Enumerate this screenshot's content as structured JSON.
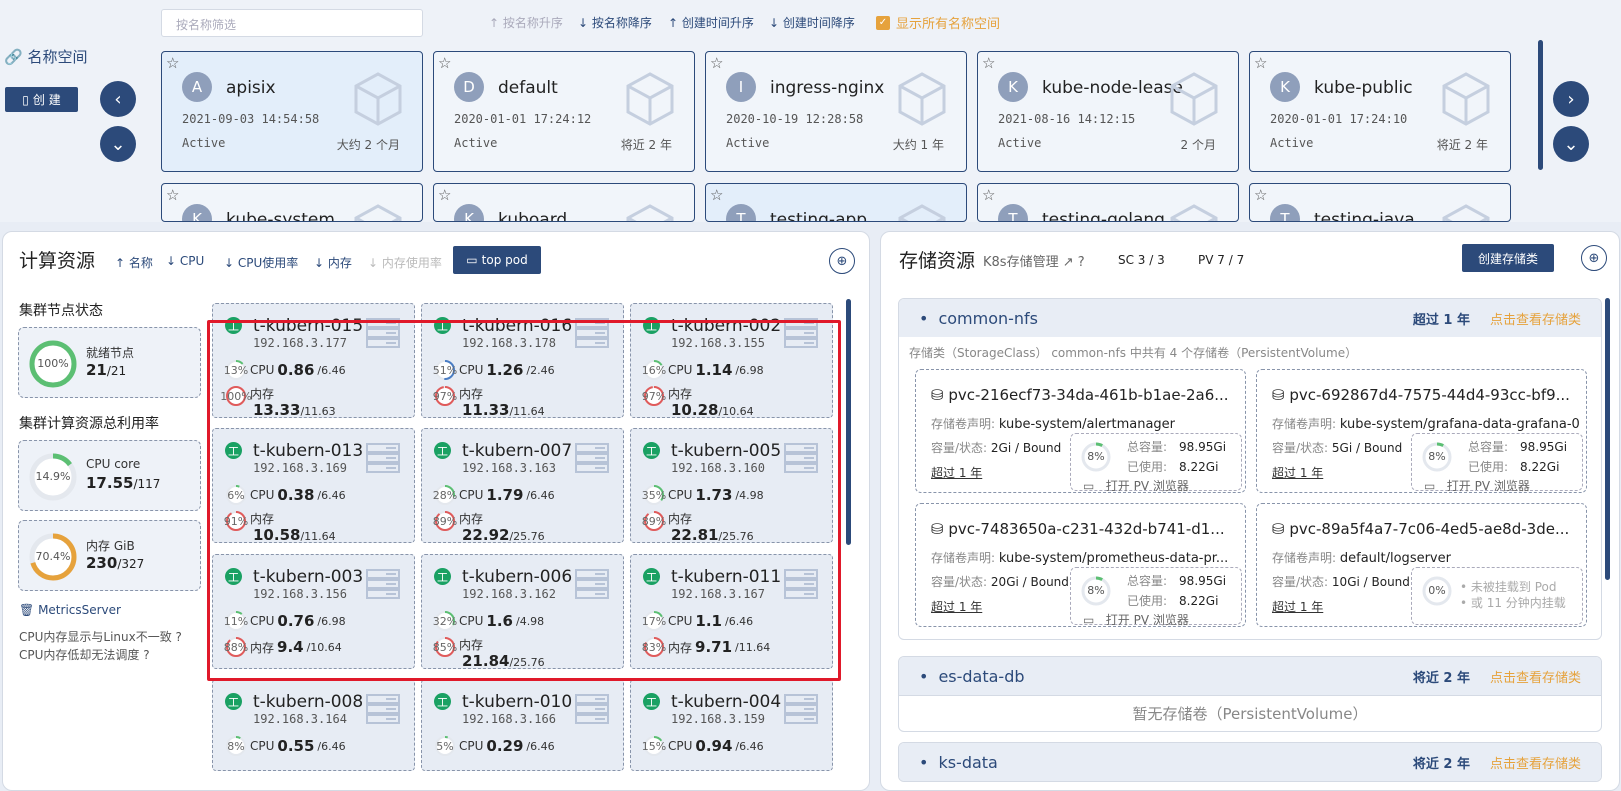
{
  "namespace": {
    "title": "名称空间",
    "create_label": "创 建",
    "filter_placeholder": "按名称筛选",
    "sort": [
      "按名称升序",
      "按名称降序",
      "创建时间升序",
      "创建时间降序"
    ],
    "show_all_label": "显示所有名称空间",
    "cards": [
      {
        "initial": "A",
        "name": "apisix",
        "date": "2021-09-03 14:54:58",
        "status": "Active",
        "age": "大约 2 个月",
        "selected": true
      },
      {
        "initial": "D",
        "name": "default",
        "date": "2020-01-01 17:24:12",
        "status": "Active",
        "age": "将近 2 年"
      },
      {
        "initial": "I",
        "name": "ingress-nginx",
        "date": "2020-10-19 12:28:58",
        "status": "Active",
        "age": "大约 1 年"
      },
      {
        "initial": "K",
        "name": "kube-node-lease",
        "date": "2021-08-16 14:12:15",
        "status": "Active",
        "age": "2 个月"
      },
      {
        "initial": "K",
        "name": "kube-public",
        "date": "2020-01-01 17:24:10",
        "status": "Active",
        "age": "将近 2 年"
      },
      {
        "initial": "K",
        "name": "kube-system"
      },
      {
        "initial": "K",
        "name": "kuboard"
      },
      {
        "initial": "T",
        "name": "testing-app",
        "selected": true
      },
      {
        "initial": "T",
        "name": "testing-golang"
      },
      {
        "initial": "T",
        "name": "testing-java"
      }
    ]
  },
  "compute": {
    "title": "计算资源",
    "sort": [
      "名称",
      "CPU",
      "CPU使用率",
      "内存",
      "内存使用率"
    ],
    "top_pod_label": "top pod",
    "node_status_title": "集群节点状态",
    "ready_nodes": {
      "label": "就绪节点",
      "value": "21",
      "total": "/21",
      "percent": "100%"
    },
    "util_title": "集群计算资源总利用率",
    "cpu_core": {
      "label": "CPU core",
      "value": "17.55",
      "total": "/117",
      "percent": "14.9%"
    },
    "mem": {
      "label": "内存 GiB",
      "value": "230",
      "total": "/327",
      "percent": "70.4%"
    },
    "metrics_server": "MetricsServer",
    "note1": "CPU内存显示与Linux不一致",
    "note2": "CPU内存低却无法调度",
    "cpu_label": "CPU",
    "mem_label": "内存",
    "nodes": [
      {
        "name": "t-kubern-015",
        "ip": "192.168.3.177",
        "cpu_pct": "13%",
        "cpu": "0.86",
        "cpu_total": "/6.46",
        "mem_pct": "100%",
        "mem": "13.33",
        "mem_total": "/11.63"
      },
      {
        "name": "t-kubern-016",
        "ip": "192.168.3.178",
        "cpu_pct": "51%",
        "cpu": "1.26",
        "cpu_total": "/2.46",
        "mem_pct": "97%",
        "mem": "11.33",
        "mem_total": "/11.64"
      },
      {
        "name": "t-kubern-002",
        "ip": "192.168.3.155",
        "cpu_pct": "16%",
        "cpu": "1.14",
        "cpu_total": "/6.98",
        "mem_pct": "97%",
        "mem": "10.28",
        "mem_total": "/10.64"
      },
      {
        "name": "t-kubern-013",
        "ip": "192.168.3.169",
        "cpu_pct": "6%",
        "cpu": "0.38",
        "cpu_total": "/6.46",
        "mem_pct": "91%",
        "mem": "10.58",
        "mem_total": "/11.64"
      },
      {
        "name": "t-kubern-007",
        "ip": "192.168.3.163",
        "cpu_pct": "28%",
        "cpu": "1.79",
        "cpu_total": "/6.46",
        "mem_pct": "89%",
        "mem": "22.92",
        "mem_total": "/25.76"
      },
      {
        "name": "t-kubern-005",
        "ip": "192.168.3.160",
        "cpu_pct": "35%",
        "cpu": "1.73",
        "cpu_total": "/4.98",
        "mem_pct": "89%",
        "mem": "22.81",
        "mem_total": "/25.76"
      },
      {
        "name": "t-kubern-003",
        "ip": "192.168.3.156",
        "cpu_pct": "11%",
        "cpu": "0.76",
        "cpu_total": "/6.98",
        "mem_pct": "88%",
        "mem": "9.4",
        "mem_total": "/10.64"
      },
      {
        "name": "t-kubern-006",
        "ip": "192.168.3.162",
        "cpu_pct": "32%",
        "cpu": "1.6",
        "cpu_total": "/4.98",
        "mem_pct": "85%",
        "mem": "21.84",
        "mem_total": "/25.76"
      },
      {
        "name": "t-kubern-011",
        "ip": "192.168.3.167",
        "cpu_pct": "17%",
        "cpu": "1.1",
        "cpu_total": "/6.46",
        "mem_pct": "83%",
        "mem": "9.71",
        "mem_total": "/11.64"
      },
      {
        "name": "t-kubern-008",
        "ip": "192.168.3.164",
        "cpu_pct": "8%",
        "cpu": "0.55",
        "cpu_total": "/6.46"
      },
      {
        "name": "t-kubern-010",
        "ip": "192.168.3.166",
        "cpu_pct": "5%",
        "cpu": "0.29",
        "cpu_total": "/6.46"
      },
      {
        "name": "t-kubern-004",
        "ip": "192.168.3.159",
        "cpu_pct": "15%",
        "cpu": "0.94",
        "cpu_total": "/6.46"
      }
    ]
  },
  "storage": {
    "title": "存储资源",
    "k8s_link": "K8s存储管理",
    "sc_count": "SC 3 / 3",
    "pv_count": "PV 7 / 7",
    "create_label": "创建存储类",
    "claim_label": "存储卷声明:",
    "cap_label": "容量/状态:",
    "total_label": "总容量:",
    "used_label": "已使用:",
    "open_label": "打开 PV 浏览器",
    "view_link": "点击查看存储类",
    "classes": [
      {
        "name": "common-nfs",
        "age": "超过 1 年",
        "desc": "存储类（StorageClass） common-nfs 中共有 4 个存储卷（PersistentVolume）",
        "pvs": [
          {
            "name": "pvc-216ecf73-34da-461b-b1ae-2a6...",
            "claim": "kube-system/alertmanager",
            "cap": "2Gi / Bound",
            "age": "超过 1 年",
            "pct": "8%",
            "total": "98.95Gi",
            "used": "8.22Gi"
          },
          {
            "name": "pvc-692867d4-7575-44d4-93cc-bf9...",
            "claim": "kube-system/grafana-data-grafana-0",
            "cap": "5Gi / Bound",
            "age": "超过 1 年",
            "pct": "8%",
            "total": "98.95Gi",
            "used": "8.22Gi"
          },
          {
            "name": "pvc-7483650a-c231-432d-b741-d1...",
            "claim": "kube-system/prometheus-data-pr...",
            "cap": "20Gi / Bound",
            "age": "超过 1 年",
            "pct": "8%",
            "total": "98.95Gi",
            "used": "8.22Gi"
          },
          {
            "name": "pvc-89a5f4a7-7c06-4ed5-ae8d-3de...",
            "claim": "default/logserver",
            "cap": "10Gi / Bound",
            "age": "超过 1 年",
            "pct": "0%",
            "unmounted1": "未被挂载到 Pod",
            "unmounted2": "或 11 分钟内挂载"
          }
        ]
      },
      {
        "name": "es-data-db",
        "age": "将近 2 年",
        "empty": "暂无存储卷（PersistentVolume）"
      },
      {
        "name": "ks-data",
        "age": "将近 2 年"
      }
    ]
  },
  "colors": {
    "primary": "#2c4a7a",
    "accent": "#e6a23c",
    "green": "#1aa163",
    "red": "#e0192a"
  }
}
